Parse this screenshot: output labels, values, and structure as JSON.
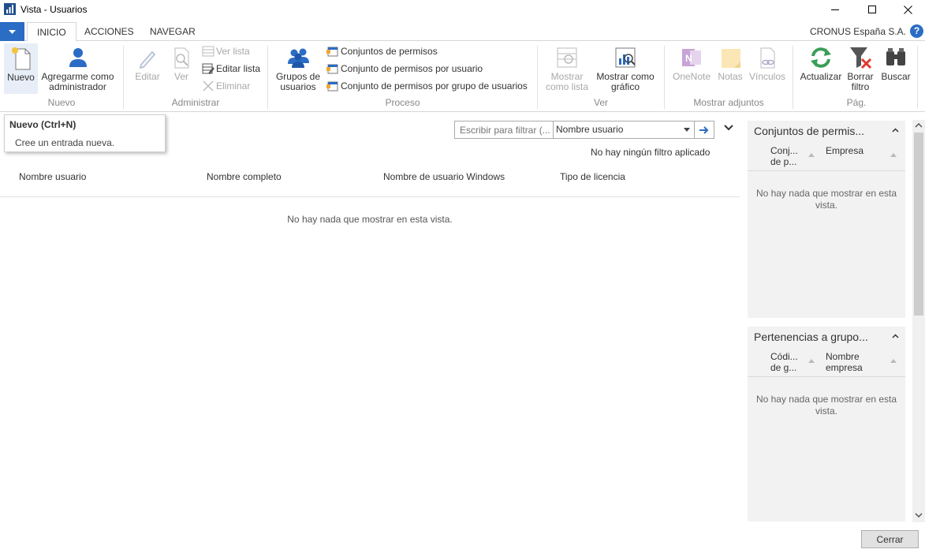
{
  "window": {
    "title": "Vista - Usuarios"
  },
  "ribbon_tabs": [
    "INICIO",
    "ACCIONES",
    "NAVEGAR"
  ],
  "company": "CRONUS España S.A.",
  "help_label": "?",
  "ribbon": {
    "nuevo": {
      "label": "Nuevo",
      "agregar_line1": "Agregarme como",
      "agregar_line2": "administrador",
      "group": "Nuevo"
    },
    "administrar": {
      "editar": "Editar",
      "ver": "Ver",
      "ver_lista": "Ver lista",
      "editar_lista": "Editar lista",
      "eliminar": "Eliminar",
      "group": "Administrar"
    },
    "proceso": {
      "grupos_line1": "Grupos de",
      "grupos_line2": "usuarios",
      "conjuntos": "Conjuntos de permisos",
      "conjunto_usuario": "Conjunto de permisos por usuario",
      "conjunto_grupo": "Conjunto de permisos por grupo de usuarios",
      "group": "Proceso"
    },
    "ver": {
      "mostrar_lista_1": "Mostrar",
      "mostrar_lista_2": "como lista",
      "mostrar_grafico_1": "Mostrar como",
      "mostrar_grafico_2": "gráfico",
      "group": "Ver"
    },
    "adjuntos": {
      "onenote": "OneNote",
      "notas": "Notas",
      "vinculos": "Vínculos",
      "group": "Mostrar adjuntos"
    },
    "pag": {
      "actualizar": "Actualizar",
      "borrar_1": "Borrar",
      "borrar_2": "filtro",
      "buscar": "Buscar",
      "group": "Pág."
    }
  },
  "tooltip": {
    "title": "Nuevo (Ctrl+N)",
    "description": "Cree un entrada nueva."
  },
  "filter": {
    "placeholder": "Escribir para filtrar (...",
    "field": "Nombre usuario",
    "status": "No hay ningún filtro aplicado"
  },
  "list": {
    "columns": [
      "Nombre usuario",
      "Nombre completo",
      "Nombre de usuario Windows",
      "Tipo de licencia"
    ],
    "empty": "No hay nada que mostrar en esta vista."
  },
  "factboxes": {
    "permisos": {
      "title": "Conjuntos de permis...",
      "col1_line1": "Conj...",
      "col1_line2": "de p...",
      "col2": "Empresa",
      "empty_line1": "No hay nada que mostrar en esta",
      "empty_line2": "vista."
    },
    "grupos": {
      "title": "Pertenencias a grupo...",
      "col1_line1": "Códi...",
      "col1_line2": "de g...",
      "col2_line1": "Nombre",
      "col2_line2": "empresa",
      "empty_line1": "No hay nada que mostrar en esta",
      "empty_line2": "vista."
    }
  },
  "close_label": "Cerrar",
  "colors": {
    "accent": "#2b6cc4",
    "factbox_bg": "#f2f2f2"
  }
}
